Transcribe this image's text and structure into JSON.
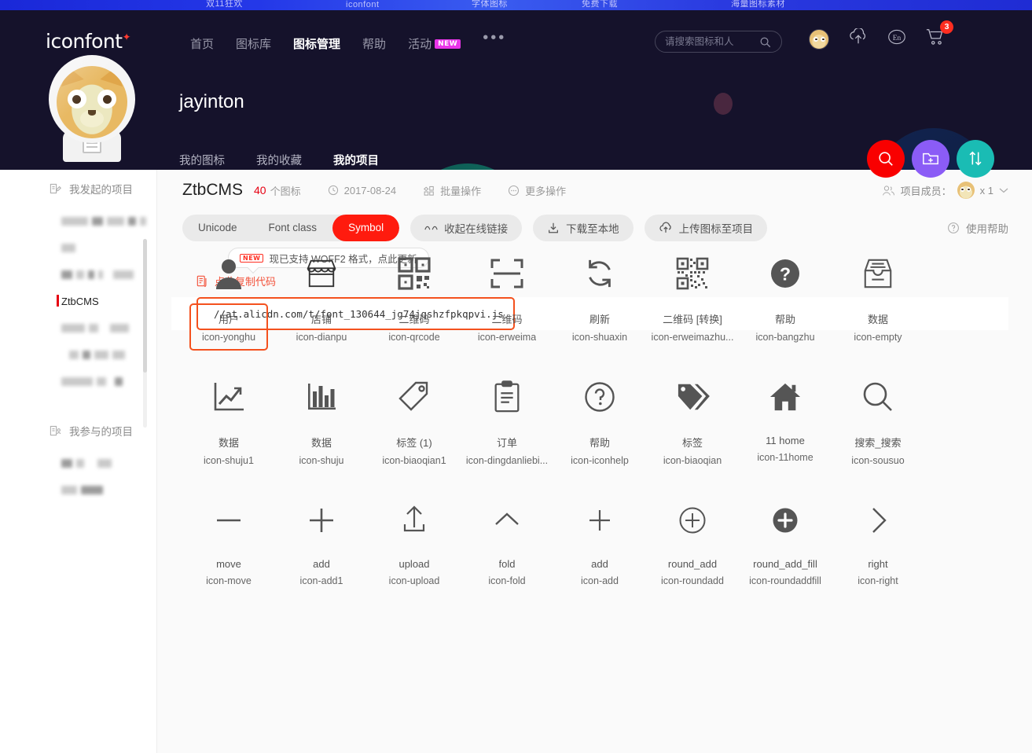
{
  "promo": {
    "fragments": [
      "双11狂欢",
      "iconfont",
      "字体图标",
      "免费下载",
      "海量图标素材"
    ]
  },
  "nav": {
    "logo": "iconfont",
    "items": [
      {
        "label": "首页",
        "active": false
      },
      {
        "label": "图标库",
        "active": false
      },
      {
        "label": "图标管理",
        "active": true
      },
      {
        "label": "帮助",
        "active": false
      },
      {
        "label": "活动",
        "active": false,
        "badge": "NEW"
      }
    ],
    "more_dots": "•••",
    "search_placeholder": "请搜索图标和人",
    "search_value": "",
    "lang_label": "En",
    "cart_count": "3"
  },
  "profile": {
    "username": "jayinton",
    "tabs": [
      {
        "label": "我的图标",
        "active": false
      },
      {
        "label": "我的收藏",
        "active": false
      },
      {
        "label": "我的项目",
        "active": true
      }
    ]
  },
  "float_buttons": [
    {
      "name": "search",
      "icon": "search-icon",
      "color": "#f90000"
    },
    {
      "name": "new-project",
      "icon": "folder-add-icon",
      "color": "#8b5cf6"
    },
    {
      "name": "sort",
      "icon": "sort-icon",
      "color": "#1abcb4"
    }
  ],
  "sidebar": {
    "sections": [
      {
        "title": "我发起的项目",
        "icon": "project-create-icon",
        "items": [
          {
            "label": "",
            "redacted": true,
            "widths": [
              34,
              14,
              22,
              10,
              8
            ],
            "active": false
          },
          {
            "label": "",
            "redacted": true,
            "widths": [
              18
            ],
            "active": false
          },
          {
            "label": "",
            "redacted": true,
            "widths": [
              14,
              10,
              8,
              6,
              26
            ],
            "active": false
          },
          {
            "label": "ZtbCMS",
            "redacted": false,
            "active": true
          },
          {
            "label": "",
            "redacted": true,
            "widths": [
              30,
              12,
              24
            ],
            "active": false
          },
          {
            "label": "",
            "redacted": true,
            "widths": [
              12,
              10,
              18,
              16
            ],
            "active": false
          },
          {
            "label": "",
            "redacted": true,
            "widths": [
              40,
              12,
              10
            ],
            "active": false
          }
        ]
      },
      {
        "title": "我参与的项目",
        "icon": "project-join-icon",
        "items": [
          {
            "label": "",
            "redacted": true,
            "widths": [
              14,
              10,
              18
            ],
            "active": false
          },
          {
            "label": "",
            "redacted": true,
            "widths": [
              20,
              28
            ],
            "active": false
          }
        ]
      }
    ]
  },
  "project": {
    "title": "ZtbCMS",
    "icon_count": "40",
    "icon_count_label": "个图标",
    "date": "2017-08-24",
    "date_icon": "clock-icon",
    "batch_label": "批量操作",
    "batch_icon": "batch-icon",
    "more_label": "更多操作",
    "more_icon": "ellipsis-circle-icon",
    "members_label": "项目成员：",
    "members_icon": "users-icon",
    "members_count": "x 1",
    "members_chevron": "chevron-down-icon"
  },
  "toolbar": {
    "segments": [
      {
        "label": "Unicode",
        "active": false
      },
      {
        "label": "Font class",
        "active": false
      },
      {
        "label": "Symbol",
        "active": true
      }
    ],
    "collapse_link_label": "收起在线链接",
    "collapse_link_icon": "link-icon",
    "download_label": "下载至本地",
    "download_icon": "download-icon",
    "upload_label": "上传图标至项目",
    "upload_icon": "cloud-upload-icon",
    "help_label": "使用帮助",
    "help_icon": "question-circle-icon"
  },
  "woff_tip": {
    "badge": "NEW",
    "text": "现已支持 WOFF2 格式，点此更新"
  },
  "copy_code": {
    "icon": "copy-icon",
    "label": "点此复制代码"
  },
  "code": {
    "url": "//at.alicdn.com/t/font_130644_jg74jqshzfpkqpvi.js"
  },
  "icons": [
    {
      "name": "用户",
      "code": "icon-yonghu",
      "glyph": "user-icon",
      "selected": true
    },
    {
      "name": "店铺",
      "code": "icon-dianpu",
      "glyph": "shop-icon",
      "selected": false
    },
    {
      "name": "二维码",
      "code": "icon-qrcode",
      "glyph": "qrcode-icon",
      "selected": false
    },
    {
      "name": "二维码",
      "code": "icon-erweima",
      "glyph": "scan-icon",
      "selected": false
    },
    {
      "name": "刷新",
      "code": "icon-shuaxin",
      "glyph": "refresh-icon",
      "selected": false
    },
    {
      "name": "二维码 [转换]",
      "code": "icon-erweimazhu...",
      "glyph": "qrcode-dense-icon",
      "selected": false
    },
    {
      "name": "帮助",
      "code": "icon-bangzhu",
      "glyph": "question-filled-icon",
      "selected": false
    },
    {
      "name": "数据",
      "code": "icon-empty",
      "glyph": "inbox-icon",
      "selected": false
    },
    {
      "name": "数据",
      "code": "icon-shuju1",
      "glyph": "line-chart-icon",
      "selected": false
    },
    {
      "name": "数据",
      "code": "icon-shuju",
      "glyph": "bar-chart-icon",
      "selected": false
    },
    {
      "name": "标签 (1)",
      "code": "icon-biaoqian1",
      "glyph": "tag-outline-icon",
      "selected": false
    },
    {
      "name": "订单",
      "code": "icon-dingdanliebi...",
      "glyph": "clipboard-icon",
      "selected": false
    },
    {
      "name": "帮助",
      "code": "icon-iconhelp",
      "glyph": "question-outline-icon",
      "selected": false
    },
    {
      "name": "标签",
      "code": "icon-biaoqian",
      "glyph": "tags-filled-icon",
      "selected": false
    },
    {
      "name": "11 home",
      "code": "icon-11home",
      "glyph": "home-icon",
      "selected": false
    },
    {
      "name": "搜索_搜索",
      "code": "icon-sousuo",
      "glyph": "magnifier-icon",
      "selected": false
    },
    {
      "name": "move",
      "code": "icon-move",
      "glyph": "minus-icon",
      "selected": false
    },
    {
      "name": "add",
      "code": "icon-add1",
      "glyph": "plus-icon",
      "selected": false
    },
    {
      "name": "upload",
      "code": "icon-upload",
      "glyph": "upload-box-icon",
      "selected": false
    },
    {
      "name": "fold",
      "code": "icon-fold",
      "glyph": "chevron-up-icon",
      "selected": false
    },
    {
      "name": "add",
      "code": "icon-add",
      "glyph": "plus-thin-icon",
      "selected": false
    },
    {
      "name": "round_add",
      "code": "icon-roundadd",
      "glyph": "plus-circle-outline-icon",
      "selected": false
    },
    {
      "name": "round_add_fill",
      "code": "icon-roundaddfill",
      "glyph": "plus-circle-filled-icon",
      "selected": false
    },
    {
      "name": "right",
      "code": "icon-right",
      "glyph": "chevron-right-icon",
      "selected": false
    }
  ]
}
